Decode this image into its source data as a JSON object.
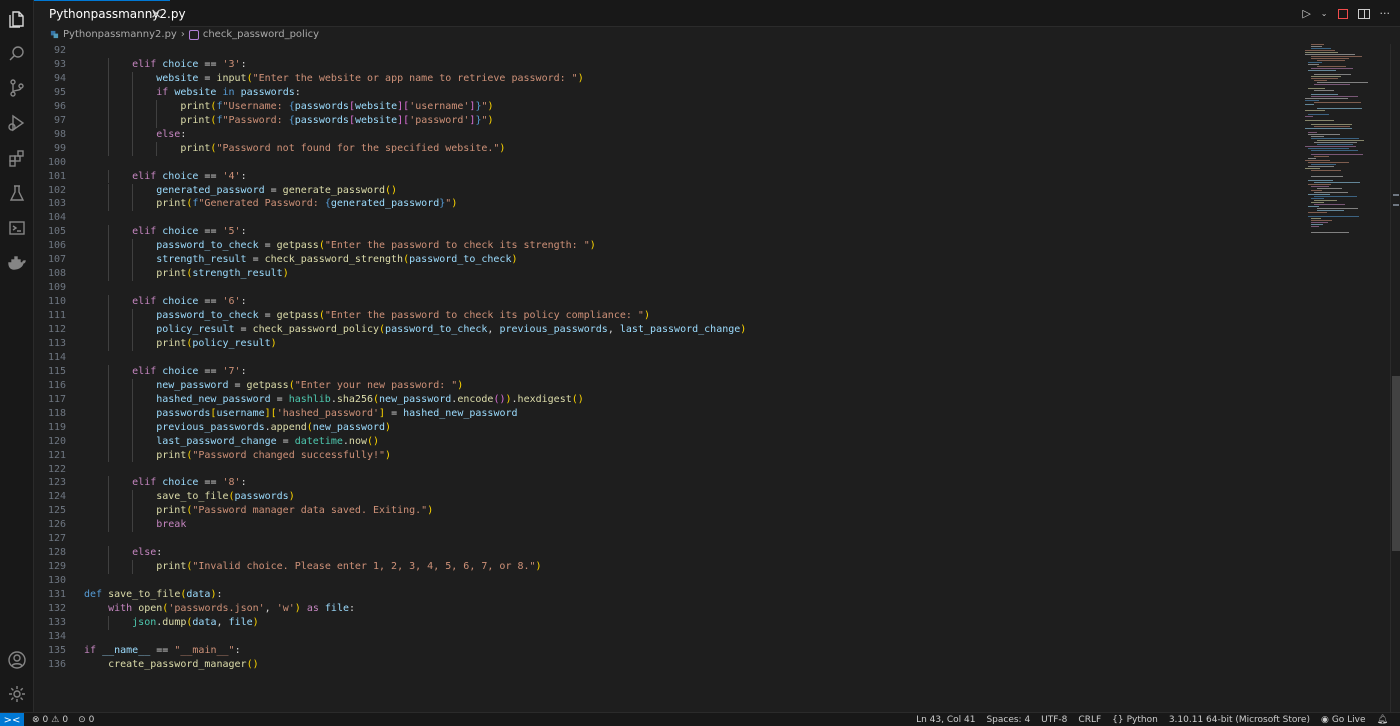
{
  "tab": {
    "filename": "Pythonpassmanny2.py",
    "close": "×"
  },
  "breadcrumb": {
    "file": "Pythonpassmanny2.py",
    "separator": "›",
    "symbol": "check_password_policy"
  },
  "activity_bar": [
    "explorer-icon",
    "search-icon",
    "source-control-icon",
    "run-debug-icon",
    "extensions-icon",
    "testing-icon",
    "terminal-icon",
    "docker-icon",
    "accounts-icon",
    "settings-gear-icon"
  ],
  "colors": {
    "keyword": "#c586c0",
    "function": "#dcdcaa",
    "variable": "#9cdcfe",
    "string": "#ce9178",
    "accent": "#0078d4"
  },
  "code_lines": [
    {
      "n": "92",
      "i": 0,
      "t": []
    },
    {
      "n": "93",
      "i": 2,
      "t": [
        [
          "kw",
          "elif"
        ],
        [
          "pn",
          " "
        ],
        [
          "var",
          "choice"
        ],
        [
          "pn",
          " == "
        ],
        [
          "str",
          "'3'"
        ],
        [
          "pn",
          ":"
        ]
      ]
    },
    {
      "n": "94",
      "i": 3,
      "t": [
        [
          "var",
          "website"
        ],
        [
          "pn",
          " = "
        ],
        [
          "fn",
          "input"
        ],
        [
          "br1",
          "("
        ],
        [
          "str",
          "\"Enter the website or app name to retrieve password: \""
        ],
        [
          "br1",
          ")"
        ]
      ]
    },
    {
      "n": "95",
      "i": 3,
      "t": [
        [
          "kw",
          "if"
        ],
        [
          "pn",
          " "
        ],
        [
          "var",
          "website"
        ],
        [
          "pn",
          " "
        ],
        [
          "kb",
          "in"
        ],
        [
          "pn",
          " "
        ],
        [
          "var",
          "passwords"
        ],
        [
          "pn",
          ":"
        ]
      ]
    },
    {
      "n": "96",
      "i": 4,
      "t": [
        [
          "fn",
          "print"
        ],
        [
          "br1",
          "("
        ],
        [
          "kb",
          "f"
        ],
        [
          "str",
          "\"Username: "
        ],
        [
          "kb",
          "{"
        ],
        [
          "var",
          "passwords"
        ],
        [
          "br2",
          "["
        ],
        [
          "var",
          "website"
        ],
        [
          "br2",
          "]"
        ],
        [
          "br2",
          "["
        ],
        [
          "str",
          "'username'"
        ],
        [
          "br2",
          "]"
        ],
        [
          "kb",
          "}"
        ],
        [
          "str",
          "\""
        ],
        [
          "br1",
          ")"
        ]
      ]
    },
    {
      "n": "97",
      "i": 4,
      "t": [
        [
          "fn",
          "print"
        ],
        [
          "br1",
          "("
        ],
        [
          "kb",
          "f"
        ],
        [
          "str",
          "\"Password: "
        ],
        [
          "kb",
          "{"
        ],
        [
          "var",
          "passwords"
        ],
        [
          "br2",
          "["
        ],
        [
          "var",
          "website"
        ],
        [
          "br2",
          "]"
        ],
        [
          "br2",
          "["
        ],
        [
          "str",
          "'password'"
        ],
        [
          "br2",
          "]"
        ],
        [
          "kb",
          "}"
        ],
        [
          "str",
          "\""
        ],
        [
          "br1",
          ")"
        ]
      ]
    },
    {
      "n": "98",
      "i": 3,
      "t": [
        [
          "kw",
          "else"
        ],
        [
          "pn",
          ":"
        ]
      ]
    },
    {
      "n": "99",
      "i": 4,
      "t": [
        [
          "fn",
          "print"
        ],
        [
          "br1",
          "("
        ],
        [
          "str",
          "\"Password not found for the specified website.\""
        ],
        [
          "br1",
          ")"
        ]
      ]
    },
    {
      "n": "100",
      "i": 0,
      "t": []
    },
    {
      "n": "101",
      "i": 2,
      "t": [
        [
          "kw",
          "elif"
        ],
        [
          "pn",
          " "
        ],
        [
          "var",
          "choice"
        ],
        [
          "pn",
          " == "
        ],
        [
          "str",
          "'4'"
        ],
        [
          "pn",
          ":"
        ]
      ]
    },
    {
      "n": "102",
      "i": 3,
      "t": [
        [
          "var",
          "generated_password"
        ],
        [
          "pn",
          " = "
        ],
        [
          "fn",
          "generate_password"
        ],
        [
          "br1",
          "()"
        ]
      ]
    },
    {
      "n": "103",
      "i": 3,
      "t": [
        [
          "fn",
          "print"
        ],
        [
          "br1",
          "("
        ],
        [
          "kb",
          "f"
        ],
        [
          "str",
          "\"Generated Password: "
        ],
        [
          "kb",
          "{"
        ],
        [
          "var",
          "generated_password"
        ],
        [
          "kb",
          "}"
        ],
        [
          "str",
          "\""
        ],
        [
          "br1",
          ")"
        ]
      ]
    },
    {
      "n": "104",
      "i": 0,
      "t": []
    },
    {
      "n": "105",
      "i": 2,
      "t": [
        [
          "kw",
          "elif"
        ],
        [
          "pn",
          " "
        ],
        [
          "var",
          "choice"
        ],
        [
          "pn",
          " == "
        ],
        [
          "str",
          "'5'"
        ],
        [
          "pn",
          ":"
        ]
      ]
    },
    {
      "n": "106",
      "i": 3,
      "t": [
        [
          "var",
          "password_to_check"
        ],
        [
          "pn",
          " = "
        ],
        [
          "fn",
          "getpass"
        ],
        [
          "br1",
          "("
        ],
        [
          "str",
          "\"Enter the password to check its strength: \""
        ],
        [
          "br1",
          ")"
        ]
      ]
    },
    {
      "n": "107",
      "i": 3,
      "t": [
        [
          "var",
          "strength_result"
        ],
        [
          "pn",
          " = "
        ],
        [
          "fn",
          "check_password_strength"
        ],
        [
          "br1",
          "("
        ],
        [
          "var",
          "password_to_check"
        ],
        [
          "br1",
          ")"
        ]
      ]
    },
    {
      "n": "108",
      "i": 3,
      "t": [
        [
          "fn",
          "print"
        ],
        [
          "br1",
          "("
        ],
        [
          "var",
          "strength_result"
        ],
        [
          "br1",
          ")"
        ]
      ]
    },
    {
      "n": "109",
      "i": 0,
      "t": []
    },
    {
      "n": "110",
      "i": 2,
      "t": [
        [
          "kw",
          "elif"
        ],
        [
          "pn",
          " "
        ],
        [
          "var",
          "choice"
        ],
        [
          "pn",
          " == "
        ],
        [
          "str",
          "'6'"
        ],
        [
          "pn",
          ":"
        ]
      ]
    },
    {
      "n": "111",
      "i": 3,
      "t": [
        [
          "var",
          "password_to_check"
        ],
        [
          "pn",
          " = "
        ],
        [
          "fn",
          "getpass"
        ],
        [
          "br1",
          "("
        ],
        [
          "str",
          "\"Enter the password to check its policy compliance: \""
        ],
        [
          "br1",
          ")"
        ]
      ]
    },
    {
      "n": "112",
      "i": 3,
      "t": [
        [
          "var",
          "policy_result"
        ],
        [
          "pn",
          " = "
        ],
        [
          "fn",
          "check_password_policy"
        ],
        [
          "br1",
          "("
        ],
        [
          "var",
          "password_to_check"
        ],
        [
          "pn",
          ", "
        ],
        [
          "var",
          "previous_passwords"
        ],
        [
          "pn",
          ", "
        ],
        [
          "var",
          "last_password_change"
        ],
        [
          "br1",
          ")"
        ]
      ]
    },
    {
      "n": "113",
      "i": 3,
      "t": [
        [
          "fn",
          "print"
        ],
        [
          "br1",
          "("
        ],
        [
          "var",
          "policy_result"
        ],
        [
          "br1",
          ")"
        ]
      ]
    },
    {
      "n": "114",
      "i": 0,
      "t": []
    },
    {
      "n": "115",
      "i": 2,
      "t": [
        [
          "kw",
          "elif"
        ],
        [
          "pn",
          " "
        ],
        [
          "var",
          "choice"
        ],
        [
          "pn",
          " == "
        ],
        [
          "str",
          "'7'"
        ],
        [
          "pn",
          ":"
        ]
      ]
    },
    {
      "n": "116",
      "i": 3,
      "t": [
        [
          "var",
          "new_password"
        ],
        [
          "pn",
          " = "
        ],
        [
          "fn",
          "getpass"
        ],
        [
          "br1",
          "("
        ],
        [
          "str",
          "\"Enter your new password: \""
        ],
        [
          "br1",
          ")"
        ]
      ]
    },
    {
      "n": "117",
      "i": 3,
      "t": [
        [
          "var",
          "hashed_new_password"
        ],
        [
          "pn",
          " = "
        ],
        [
          "cls",
          "hashlib"
        ],
        [
          "pn",
          "."
        ],
        [
          "fn",
          "sha256"
        ],
        [
          "br1",
          "("
        ],
        [
          "var",
          "new_password"
        ],
        [
          "pn",
          "."
        ],
        [
          "fn",
          "encode"
        ],
        [
          "br2",
          "()"
        ],
        [
          "br1",
          ")"
        ],
        [
          "pn",
          "."
        ],
        [
          "fn",
          "hexdigest"
        ],
        [
          "br1",
          "()"
        ]
      ]
    },
    {
      "n": "118",
      "i": 3,
      "t": [
        [
          "var",
          "passwords"
        ],
        [
          "br1",
          "["
        ],
        [
          "var",
          "username"
        ],
        [
          "br1",
          "]"
        ],
        [
          "br1",
          "["
        ],
        [
          "str",
          "'hashed_password'"
        ],
        [
          "br1",
          "]"
        ],
        [
          "pn",
          " = "
        ],
        [
          "var",
          "hashed_new_password"
        ]
      ]
    },
    {
      "n": "119",
      "i": 3,
      "t": [
        [
          "var",
          "previous_passwords"
        ],
        [
          "pn",
          "."
        ],
        [
          "fn",
          "append"
        ],
        [
          "br1",
          "("
        ],
        [
          "var",
          "new_password"
        ],
        [
          "br1",
          ")"
        ]
      ]
    },
    {
      "n": "120",
      "i": 3,
      "t": [
        [
          "var",
          "last_password_change"
        ],
        [
          "pn",
          " = "
        ],
        [
          "cls",
          "datetime"
        ],
        [
          "pn",
          "."
        ],
        [
          "fn",
          "now"
        ],
        [
          "br1",
          "()"
        ]
      ]
    },
    {
      "n": "121",
      "i": 3,
      "t": [
        [
          "fn",
          "print"
        ],
        [
          "br1",
          "("
        ],
        [
          "str",
          "\"Password changed successfully!\""
        ],
        [
          "br1",
          ")"
        ]
      ]
    },
    {
      "n": "122",
      "i": 0,
      "t": []
    },
    {
      "n": "123",
      "i": 2,
      "t": [
        [
          "kw",
          "elif"
        ],
        [
          "pn",
          " "
        ],
        [
          "var",
          "choice"
        ],
        [
          "pn",
          " == "
        ],
        [
          "str",
          "'8'"
        ],
        [
          "pn",
          ":"
        ]
      ]
    },
    {
      "n": "124",
      "i": 3,
      "t": [
        [
          "fn",
          "save_to_file"
        ],
        [
          "br1",
          "("
        ],
        [
          "var",
          "passwords"
        ],
        [
          "br1",
          ")"
        ]
      ]
    },
    {
      "n": "125",
      "i": 3,
      "t": [
        [
          "fn",
          "print"
        ],
        [
          "br1",
          "("
        ],
        [
          "str",
          "\"Password manager data saved. Exiting.\""
        ],
        [
          "br1",
          ")"
        ]
      ]
    },
    {
      "n": "126",
      "i": 3,
      "t": [
        [
          "kw",
          "break"
        ]
      ]
    },
    {
      "n": "127",
      "i": 0,
      "t": []
    },
    {
      "n": "128",
      "i": 2,
      "t": [
        [
          "kw",
          "else"
        ],
        [
          "pn",
          ":"
        ]
      ]
    },
    {
      "n": "129",
      "i": 3,
      "t": [
        [
          "fn",
          "print"
        ],
        [
          "br1",
          "("
        ],
        [
          "str",
          "\"Invalid choice. Please enter 1, 2, 3, 4, 5, 6, 7, or 8.\""
        ],
        [
          "br1",
          ")"
        ]
      ]
    },
    {
      "n": "130",
      "i": 0,
      "t": []
    },
    {
      "n": "131",
      "i": 0,
      "t": [
        [
          "kb",
          "def"
        ],
        [
          "pn",
          " "
        ],
        [
          "fn",
          "save_to_file"
        ],
        [
          "br1",
          "("
        ],
        [
          "var",
          "data"
        ],
        [
          "br1",
          ")"
        ],
        [
          "pn",
          ":"
        ]
      ]
    },
    {
      "n": "132",
      "i": 1,
      "t": [
        [
          "kw",
          "with"
        ],
        [
          "pn",
          " "
        ],
        [
          "fn",
          "open"
        ],
        [
          "br1",
          "("
        ],
        [
          "str",
          "'passwords.json'"
        ],
        [
          "pn",
          ", "
        ],
        [
          "str",
          "'w'"
        ],
        [
          "br1",
          ")"
        ],
        [
          "pn",
          " "
        ],
        [
          "kw",
          "as"
        ],
        [
          "pn",
          " "
        ],
        [
          "var",
          "file"
        ],
        [
          "pn",
          ":"
        ]
      ]
    },
    {
      "n": "133",
      "i": 2,
      "t": [
        [
          "cls",
          "json"
        ],
        [
          "pn",
          "."
        ],
        [
          "fn",
          "dump"
        ],
        [
          "br1",
          "("
        ],
        [
          "var",
          "data"
        ],
        [
          "pn",
          ", "
        ],
        [
          "var",
          "file"
        ],
        [
          "br1",
          ")"
        ]
      ]
    },
    {
      "n": "134",
      "i": 0,
      "t": []
    },
    {
      "n": "135",
      "i": 0,
      "t": [
        [
          "kw",
          "if"
        ],
        [
          "pn",
          " "
        ],
        [
          "var",
          "__name__"
        ],
        [
          "pn",
          " == "
        ],
        [
          "str",
          "\"__main__\""
        ],
        [
          "pn",
          ":"
        ]
      ]
    },
    {
      "n": "136",
      "i": 1,
      "t": [
        [
          "fn",
          "create_password_manager"
        ],
        [
          "br1",
          "()"
        ]
      ]
    }
  ],
  "status": {
    "remote": "><",
    "errors": "0",
    "warnings": "0",
    "ports": "0",
    "position": "Ln 43, Col 41",
    "spaces": "Spaces: 4",
    "encoding": "UTF-8",
    "eol": "CRLF",
    "language": "Python",
    "interpreter": "3.10.11 64-bit (Microsoft Store)",
    "golive": "Go Live"
  }
}
